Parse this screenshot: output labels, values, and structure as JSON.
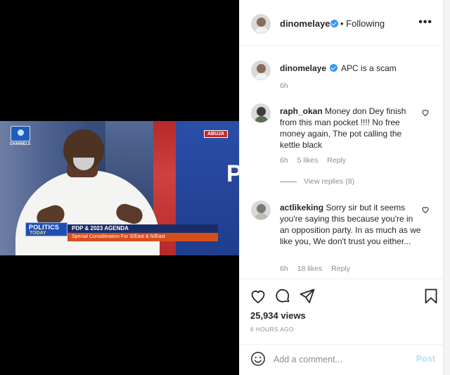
{
  "video": {
    "channel_logo_text": "CHANNELS",
    "location_tag": "ABUJA",
    "show_title_top": "POLITICS",
    "show_title_bottom": "TODAY",
    "headline": "PDP & 2023 AGENDA",
    "subheadline": "Special Consideration For S/East & N/East",
    "background_letter": "P"
  },
  "header": {
    "username": "dinomelaye",
    "follow_status": "• Following",
    "more_icon": "more-horizontal-icon"
  },
  "caption": {
    "username": "dinomelaye",
    "text": "APC is a scam",
    "time": "6h"
  },
  "comments": [
    {
      "username": "raph_okan",
      "text": "Money don Dey finish from this man pocket !!!! No free money again, The pot calling the kettle black",
      "time": "6h",
      "likes": "5 likes",
      "reply": "Reply",
      "view_replies": "View replies (8)"
    },
    {
      "username": "actlikeking",
      "text": "Sorry sir but it seems you're saying this because you're in an opposition party. In as much as we like you, We don't trust you either...",
      "time": "6h",
      "likes": "18 likes",
      "reply": "Reply"
    }
  ],
  "stats": {
    "views": "25,934 views",
    "posted": "6 HOURS AGO"
  },
  "composer": {
    "placeholder": "Add a comment...",
    "post_label": "Post"
  },
  "colors": {
    "verified_blue": "#3897f0",
    "post_disabled": "#b2dffc",
    "muted_text": "#8e8e8e"
  }
}
